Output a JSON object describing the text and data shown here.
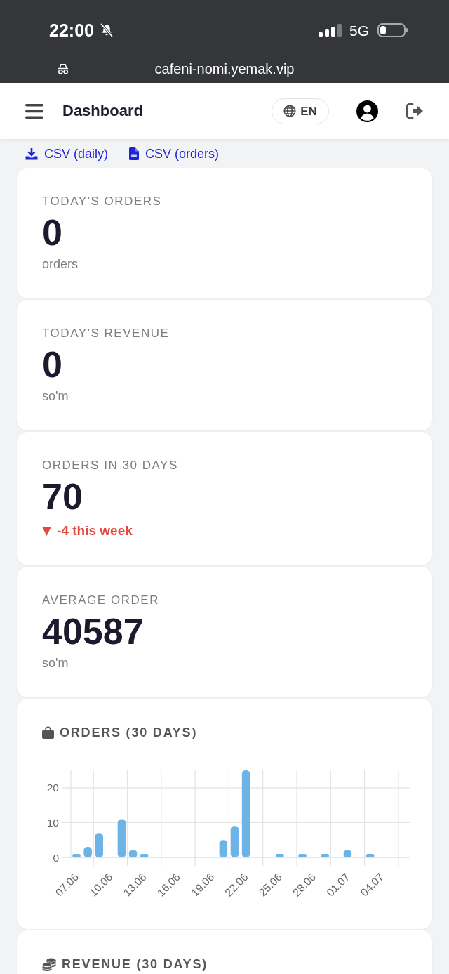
{
  "status_bar": {
    "time": "22:00",
    "network": "5G"
  },
  "browser_bar": {
    "url": "cafeni-nomi.yemak.vip"
  },
  "header": {
    "title": "Dashboard",
    "language": "EN"
  },
  "export_links": [
    {
      "label": "CSV (daily)"
    },
    {
      "label": "CSV (orders)"
    }
  ],
  "stats": [
    {
      "label": "TODAY'S ORDERS",
      "value": "0",
      "unit": "orders"
    },
    {
      "label": "TODAY'S REVENUE",
      "value": "0",
      "unit": "so'm"
    },
    {
      "label": "ORDERS IN 30 DAYS",
      "value": "70",
      "trend": {
        "arrow": "▼",
        "text": "-4 this week"
      }
    },
    {
      "label": "AVERAGE ORDER",
      "value": "40587",
      "unit": "so'm"
    }
  ],
  "orders_chart": {
    "title": "ORDERS (30 DAYS)",
    "chart_data": {
      "type": "bar",
      "categories": [
        "07.06",
        null,
        null,
        "10.06",
        null,
        null,
        "13.06",
        null,
        null,
        "16.06",
        null,
        null,
        "19.06",
        null,
        null,
        "22.06",
        null,
        null,
        "25.06",
        null,
        null,
        "28.06",
        null,
        null,
        "01.07",
        null,
        null,
        "04.07",
        null,
        null
      ],
      "values": [
        1,
        3,
        7,
        0,
        11,
        2,
        1,
        0,
        0,
        0,
        0,
        0,
        0,
        5,
        9,
        25,
        0,
        0,
        1,
        0,
        1,
        0,
        1,
        0,
        2,
        0,
        1,
        0,
        0,
        0
      ],
      "ylim": [
        0,
        25
      ],
      "yticks": [
        0,
        10,
        20
      ],
      "grid": true
    }
  },
  "revenue_chart": {
    "title": "REVENUE (30 DAYS)"
  }
}
